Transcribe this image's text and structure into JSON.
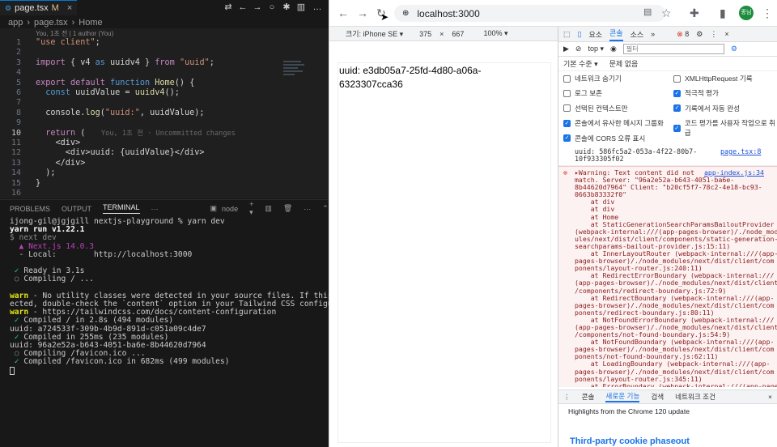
{
  "editor": {
    "tab": {
      "label": "page.tsx",
      "badge": "M"
    },
    "breadcrumb": [
      "app",
      "page.tsx",
      "Home"
    ],
    "blame_top": "You, 1초 전 | 1 author (You)",
    "inline_blame": "You, 1초 전 · Uncommitted changes",
    "lines": [
      {
        "n": "1",
        "html": "\"use client\";"
      },
      {
        "n": "2",
        "html": ""
      },
      {
        "n": "3",
        "html": "import { v4 as uuidv4 } from \"uuid\";"
      },
      {
        "n": "4",
        "html": ""
      },
      {
        "n": "5",
        "html": "export default function Home() {"
      },
      {
        "n": "6",
        "html": "  const uuidValue = uuidv4();"
      },
      {
        "n": "7",
        "html": ""
      },
      {
        "n": "8",
        "html": "  console.log(\"uuid:\", uuidValue);"
      },
      {
        "n": "9",
        "html": ""
      },
      {
        "n": "10",
        "html": "  return ("
      },
      {
        "n": "11",
        "html": "    <div>"
      },
      {
        "n": "12",
        "html": "      <div>uuid: {uuidValue}</div>"
      },
      {
        "n": "13",
        "html": "    </div>"
      },
      {
        "n": "14",
        "html": "  );"
      },
      {
        "n": "15",
        "html": "}"
      },
      {
        "n": "16",
        "html": ""
      }
    ]
  },
  "panel": {
    "tabs": [
      "PROBLEMS",
      "OUTPUT",
      "TERMINAL"
    ],
    "shell": "node",
    "terminal_lines": [
      "ijong-gil@jgjgill nextjs-playground % yarn dev",
      "yarn run v1.22.1",
      "$ next dev",
      "  ▲ Next.js 14.0.3",
      "  - Local:        http://localhost:3000",
      "",
      " ✓ Ready in 3.1s",
      " ○ Compiling / ...",
      "",
      "warn - No utility classes were detected in your source files. If this is unexp",
      "ected, double-check the `content` option in your Tailwind CSS configuration.",
      "warn - https://tailwindcss.com/docs/content-configuration",
      " ✓ Compiled / in 2.8s (494 modules)",
      "uuid: a724533f-309b-4b9d-891d-c051a09c4de7",
      " ✓ Compiled in 255ms (235 modules)",
      "uuid: 96a2e52a-b643-4051-ba6e-8b44620d7964",
      " ○ Compiling /favicon.ico ...",
      " ✓ Compiled /favicon.ico in 682ms (499 modules)"
    ]
  },
  "browser": {
    "url": "localhost:3000",
    "profile": "종님",
    "device": "크기: iPhone SE",
    "width": "375",
    "height": "667",
    "zoom": "100%",
    "page_text": "uuid: e3db05a7-25fd-4d80-a06a-6323307cca36"
  },
  "devtools": {
    "tabs": [
      "요소",
      "콘솔",
      "소스"
    ],
    "active_tab": "콘솔",
    "error_count": "8",
    "context": "top",
    "filter_placeholder": "필터",
    "level": "기본 수준",
    "issues": "문제 없음",
    "settings_left": [
      {
        "label": "네트워크 숨기기",
        "on": false
      },
      {
        "label": "로그 보존",
        "on": false
      },
      {
        "label": "선택된 컨텍스트만",
        "on": false
      },
      {
        "label": "콘솔에서 유사한 메시지 그룹화",
        "on": true
      },
      {
        "label": "콘솔에 CORS 오류 표시",
        "on": true
      }
    ],
    "settings_right": [
      {
        "label": "XMLHttpRequest 기록",
        "on": false
      },
      {
        "label": "적극적 평가",
        "on": true
      },
      {
        "label": "기록에서 자동 완성",
        "on": true
      },
      {
        "label": "코드 평가를 사용자 작업으로 취급",
        "on": true
      }
    ],
    "log_uuid": "uuid: 586fc5a2-053a-4f22-80b7-\n10f933305f02",
    "log_source": "page.tsx:8",
    "error_source": "app-index.js:34",
    "error_text": "▸Warning: Text content did not\nmatch. Server: \"96a2e52a-b643-4051-ba6e-\n8b44620d7964\" Client: \"b20cf5f7-78c2-4e18-bc93-\n0663b83332f0\"\n    at div\n    at div\n    at Home\n    at StaticGenerationSearchParamsBailoutProvider\n(webpack-internal:///(app-pages-browser)/./node_mod\nules/next/dist/client/components/static-generation-\nsearchparams-bailout-provider.js:15:11)\n    at InnerLayoutRouter (webpack-internal:///(app-\npages-browser)/./node_modules/next/dist/client/com\nponents/layout-router.js:240:11)\n    at RedirectErrorBoundary (webpack-internal:///\n(app-pages-browser)/./node_modules/next/dist/client\n/components/redirect-boundary.js:72:9)\n    at RedirectBoundary (webpack-internal:///(app-\npages-browser)/./node_modules/next/dist/client/com\nponents/redirect-boundary.js:80:11)\n    at NotFoundErrorBoundary (webpack-internal:///\n(app-pages-browser)/./node_modules/next/dist/client\n/components/not-found-boundary.js:54:9)\n    at NotFoundBoundary (webpack-internal:///(app-\npages-browser)/./node_modules/next/dist/client/com\nponents/not-found-boundary.js:62:11)\n    at LoadingBoundary (webpack-internal:///(app-\npages-browser)/./node_modules/next/dist/client/com\nponents/layout-router.js:345:11)\n    at ErrorBoundary (webpack-internal:///(app-page",
    "drawer_tabs": [
      "콘솔",
      "새로운 기능",
      "검색",
      "네트워크 조건"
    ],
    "drawer_active": "새로운 기능",
    "highlights": "Highlights from the Chrome 120 update",
    "cookie": "Third-party cookie phaseout"
  }
}
